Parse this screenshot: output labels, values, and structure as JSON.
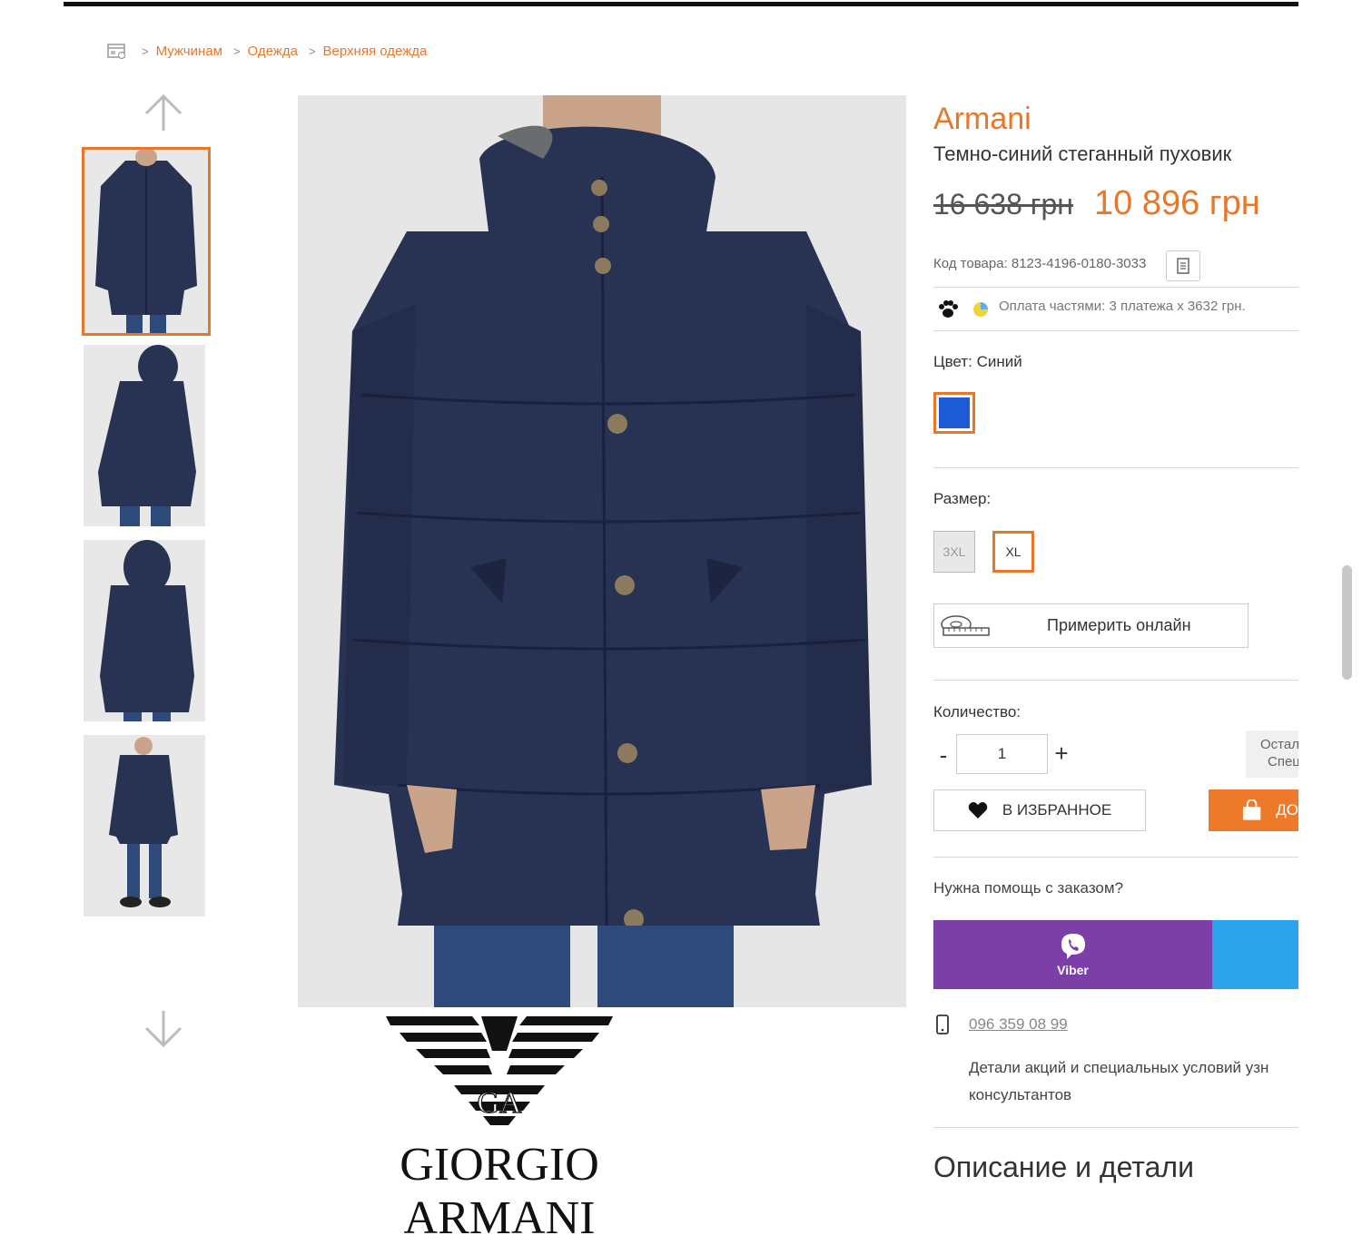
{
  "breadcrumb": {
    "items": [
      "Мужчинам",
      "Одежда",
      "Верхняя одежда"
    ],
    "separator": ">"
  },
  "product": {
    "brand": "Armani",
    "name": "Темно-синий стеганный пуховик",
    "old_price": "16 638 грн",
    "new_price": "10 896 грн",
    "sku": "Код товара: 8123-4196-0180-3033",
    "installments": "Оплата частями: 3 платежа х 3632 грн."
  },
  "color": {
    "label": "Цвет:",
    "value": "Синий",
    "swatch_hex": "#1d5bd6"
  },
  "size": {
    "label": "Размер:",
    "options": [
      "3XL",
      "XL"
    ],
    "selected": "XL"
  },
  "try_online_label": "Примерить онлайн",
  "quantity": {
    "label": "Количество:",
    "minus": "-",
    "value": "1",
    "plus": "+"
  },
  "stock_note": [
    "Остал",
    "Спец"
  ],
  "favorite_label": "В ИЗБРАННОЕ",
  "buy_label": "ДО",
  "help": {
    "question": "Нужна помощь с заказом?",
    "viber_label": "Viber",
    "phone": "096 359 08 99",
    "promo_text_1": "Детали акций и специальных условий узн",
    "promo_text_2": "консультантов"
  },
  "description_heading": "Описание и детали",
  "logo": {
    "monogram": "GA",
    "wordmark": "GIORGIO ARMANI"
  },
  "colors": {
    "accent": "#e8772a",
    "buy_button": "#ed7a2a",
    "viber": "#7b3fa7",
    "telegram": "#2aa3ea",
    "jacket": "#283252"
  },
  "icons": [
    "home-icon",
    "arrow-up-icon",
    "arrow-down-icon",
    "copy-icon",
    "paw-icon",
    "pie-icon",
    "tape-measure-icon",
    "heart-icon",
    "bag-icon",
    "viber-icon",
    "phone-icon"
  ]
}
